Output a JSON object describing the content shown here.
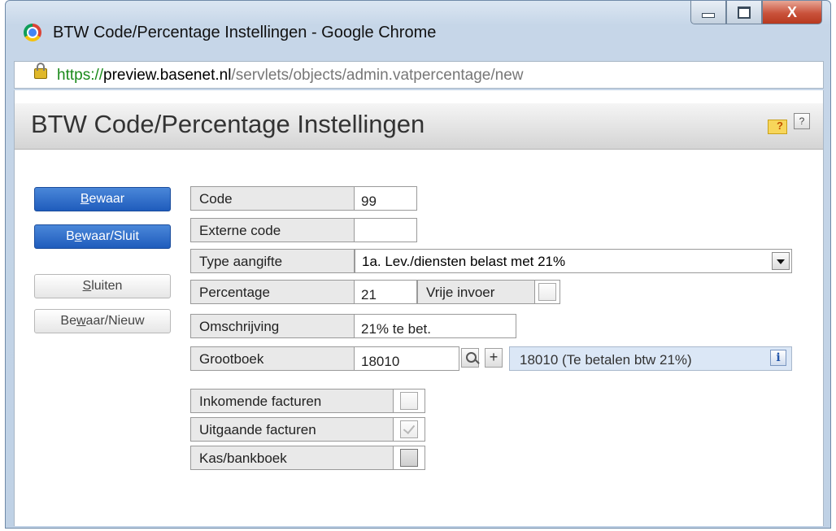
{
  "window": {
    "title": "BTW Code/Percentage Instellingen - Google Chrome",
    "minimize_icon": "minimize-icon",
    "maximize_icon": "maximize-icon",
    "close_label": "X"
  },
  "address": {
    "scheme": "https://",
    "host": "preview.basenet.nl",
    "path": "/servlets/objects/admin.vatpercentage/new"
  },
  "page": {
    "title": "BTW Code/Percentage Instellingen",
    "help_label": "?"
  },
  "actions": {
    "save_pre": "",
    "save_key": "B",
    "save_post": "ewaar",
    "saveclose_pre": "B",
    "saveclose_key": "e",
    "saveclose_post": "waar/Sluit",
    "close_pre": "",
    "close_key": "S",
    "close_post": "luiten",
    "savenew_pre": "Be",
    "savenew_key": "w",
    "savenew_post": "aar/Nieuw"
  },
  "form": {
    "code_label": "Code",
    "code_value": "99",
    "external_label": "Externe code",
    "external_value": "",
    "type_label": "Type aangifte",
    "type_value": "1a. Lev./diensten belast met 21%",
    "percentage_label": "Percentage",
    "percentage_value": "21",
    "free_input_label": "Vrije invoer",
    "free_input_checked": false,
    "description_label": "Omschrijving",
    "description_value": "21% te bet.",
    "ledger_label": "Grootboek",
    "ledger_value": "18010",
    "ledger_add": "+",
    "ledger_description": "18010 (Te betalen btw 21%)",
    "info_label": "i"
  },
  "flags": {
    "incoming_label": "Inkomende facturen",
    "incoming_checked": false,
    "outgoing_label": "Uitgaande facturen",
    "outgoing_checked": true,
    "cashbank_label": "Kas/bankboek",
    "cashbank_checked": false
  }
}
